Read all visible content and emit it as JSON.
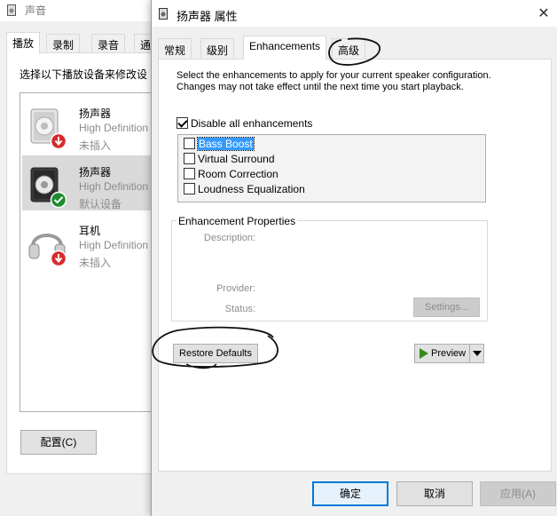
{
  "back_window": {
    "title": "声音",
    "tabs": [
      "播放",
      "录制",
      "录音",
      "通"
    ],
    "active_tab": "播放",
    "instruction": "选择以下播放设备来修改设",
    "devices": [
      {
        "name": "扬声器",
        "description": "High Definition",
        "status": "未插入",
        "icon": "speaker-icon",
        "badge": "unplugged-icon"
      },
      {
        "name": "扬声器",
        "description": "High Definition",
        "status": "默认设备",
        "icon": "speaker-icon",
        "badge": "default-check-icon"
      },
      {
        "name": "耳机",
        "description": "High Definition",
        "status": "未插入",
        "icon": "headphones-icon",
        "badge": "unplugged-icon"
      }
    ],
    "configure_label": "配置(C)"
  },
  "dialog": {
    "title": "扬声器 属性",
    "close": "✕",
    "tabs": [
      "常规",
      "级别",
      "Enhancements",
      "高级"
    ],
    "active_tab": "Enhancements",
    "description": "Select the enhancements to apply for your current speaker configuration. Changes may not take effect until the next time you start playback.",
    "disable_all": {
      "label": "Disable all enhancements",
      "checked": true
    },
    "enhancements": [
      {
        "label": "Bass Boost",
        "checked": false,
        "selected": true
      },
      {
        "label": "Virtual Surround",
        "checked": false,
        "selected": false
      },
      {
        "label": "Room Correction",
        "checked": false,
        "selected": false
      },
      {
        "label": "Loudness Equalization",
        "checked": false,
        "selected": false
      }
    ],
    "properties": {
      "legend": "Enhancement Properties",
      "description_label": "Description:",
      "provider_label": "Provider:",
      "status_label": "Status:",
      "settings_label": "Settings..."
    },
    "restore_label": "Restore Defaults",
    "preview_label": "Preview",
    "ok_label": "确定",
    "cancel_label": "取消",
    "apply_label": "应用(A)"
  },
  "colors": {
    "accent": "#0078d7",
    "selection": "#3399ff",
    "play_green": "#3a8a1a",
    "badge_red": "#d62b2b",
    "badge_green": "#1e8c2e"
  }
}
